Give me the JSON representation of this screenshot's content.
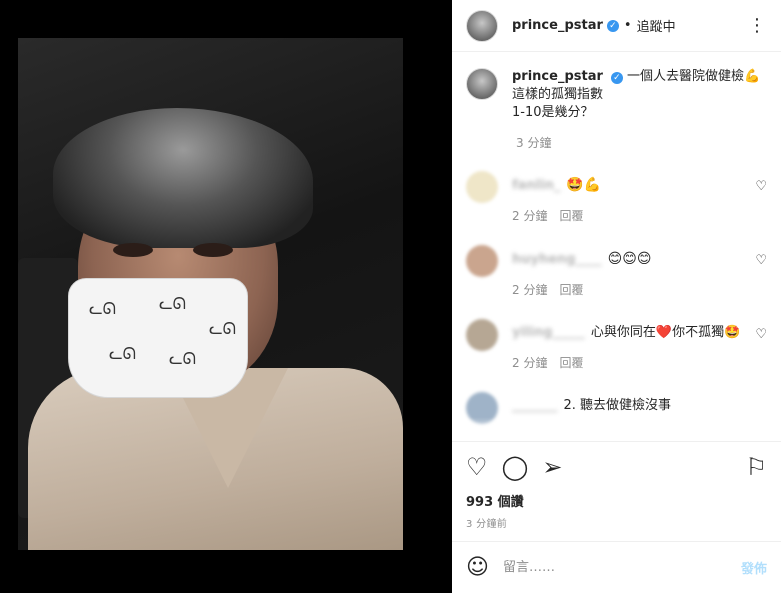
{
  "post": {
    "username": "prince_pstar",
    "dot": "•",
    "follow_label": "追蹤中",
    "more_icon": "more-horiz-icon"
  },
  "caption": {
    "username": "prince_pstar",
    "line1": "一個人去醫院做健檢💪",
    "line2": "這樣的孤獨指數",
    "line3": "1-10是幾分？",
    "time": "3 分鐘"
  },
  "comments": [
    {
      "name": "fanlin_",
      "text": "🤩💪",
      "time": "2 分鐘",
      "reply": "回覆",
      "avatar_color": "#efe6c8"
    },
    {
      "name": "huyheng____",
      "text": "😊😊😊",
      "time": "2 分鐘",
      "reply": "回覆",
      "avatar_color": "#caa58e"
    },
    {
      "name": "yiling_____",
      "text": "心與你同在❤️你不孤獨🤩",
      "time": "2 分鐘",
      "reply": "回覆",
      "avatar_color": "#b6a794"
    },
    {
      "name": "_______",
      "text": "2. 聽去做健檢沒事",
      "time": "",
      "reply": "",
      "avatar_color": "#9fb3c8"
    }
  ],
  "actions": {
    "like_icon": "heart-icon",
    "comment_icon": "comment-icon",
    "share_icon": "share-icon",
    "save_icon": "bookmark-icon"
  },
  "likes": "993 個讚",
  "posted_time": "3 分鐘前",
  "composer": {
    "placeholder": "留言……",
    "post_label": "發佈",
    "emoji_icon": "smile-icon"
  }
}
